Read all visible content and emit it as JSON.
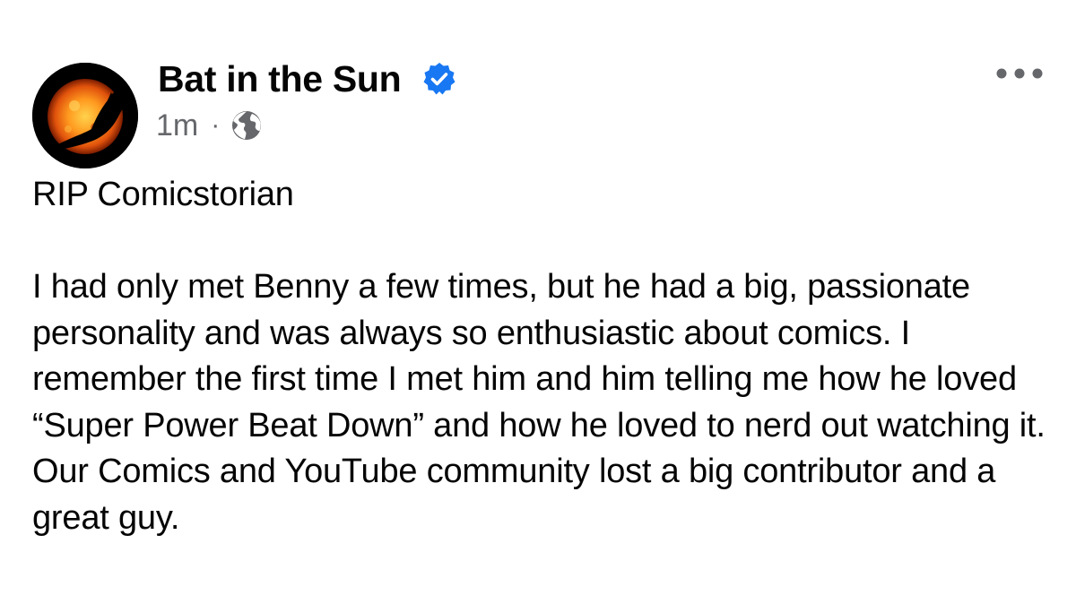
{
  "post": {
    "author": {
      "name": "Bat in the Sun",
      "verified": true,
      "avatar_icon": "bat-sun-logo",
      "verified_icon": "verified-badge-icon",
      "verified_color": "#1877f2"
    },
    "timestamp": "1m",
    "separator": "·",
    "audience_icon": "globe-icon",
    "more_icon": "more-options-icon",
    "text": {
      "headline": "RIP Comicstorian",
      "body": "I had only met Benny a few times, but he had a big, passionate personality and was always so enthusiastic about comics. I remember the first time I met him and him telling me how he loved “Super Power Beat Down” and how he loved to nerd out watching it. Our Comics and YouTube community lost a big contributor and a great guy."
    }
  },
  "colors": {
    "text_primary": "#050505",
    "text_secondary": "#65676b",
    "verified_blue": "#1877f2",
    "background": "#ffffff"
  }
}
